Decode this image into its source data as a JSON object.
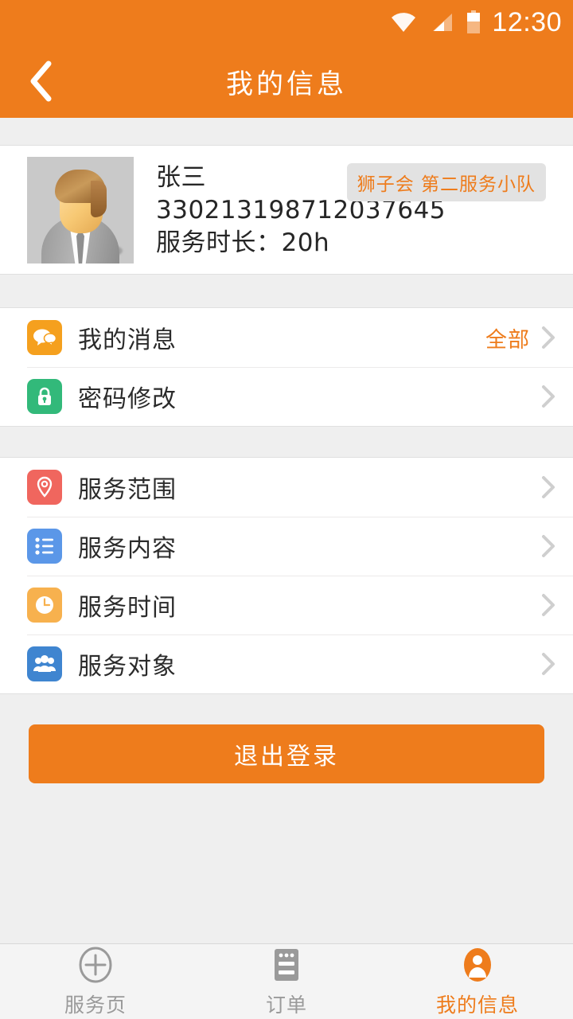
{
  "status_bar": {
    "time": "12:30",
    "icons": [
      "wifi-icon",
      "cellular-signal-icon",
      "battery-icon"
    ]
  },
  "header": {
    "title": "我的信息",
    "back_icon": "chevron-left-icon",
    "background_color": "#ee7c1c"
  },
  "profile": {
    "avatar_icon": "default-user-avatar",
    "name": "张三",
    "id_number": "330213198712037645",
    "service_hours": "服务时长：20h",
    "badge": "狮子会 第二服务小队",
    "badge_text_color": "#ee7c1c",
    "badge_bg_color": "#e2e2e2"
  },
  "menu_groups": [
    {
      "items": [
        {
          "label": "我的消息",
          "icon": "chat-bubbles-icon",
          "icon_color": "#f5a01e",
          "value": "全部"
        },
        {
          "label": "密码修改",
          "icon": "lock-icon",
          "icon_color": "#32b97a",
          "value": ""
        }
      ]
    },
    {
      "items": [
        {
          "label": "服务范围",
          "icon": "map-pin-icon",
          "icon_color": "#f0665e",
          "value": ""
        },
        {
          "label": "服务内容",
          "icon": "list-icon",
          "icon_color": "#5b97e8",
          "value": ""
        },
        {
          "label": "服务时间",
          "icon": "clock-icon",
          "icon_color": "#f7b14e",
          "value": ""
        },
        {
          "label": "服务对象",
          "icon": "people-icon",
          "icon_color": "#3f85d0",
          "value": ""
        }
      ]
    }
  ],
  "logout": {
    "label": "退出登录",
    "color": "#ee7c1c"
  },
  "tabbar": {
    "items": [
      {
        "label": "服务页",
        "icon": "plus-circle-icon",
        "active": false
      },
      {
        "label": "订单",
        "icon": "document-icon",
        "active": false
      },
      {
        "label": "我的信息",
        "icon": "person-icon",
        "active": true
      }
    ],
    "active_color": "#ee7c1c",
    "inactive_color": "#9a9a9a"
  }
}
